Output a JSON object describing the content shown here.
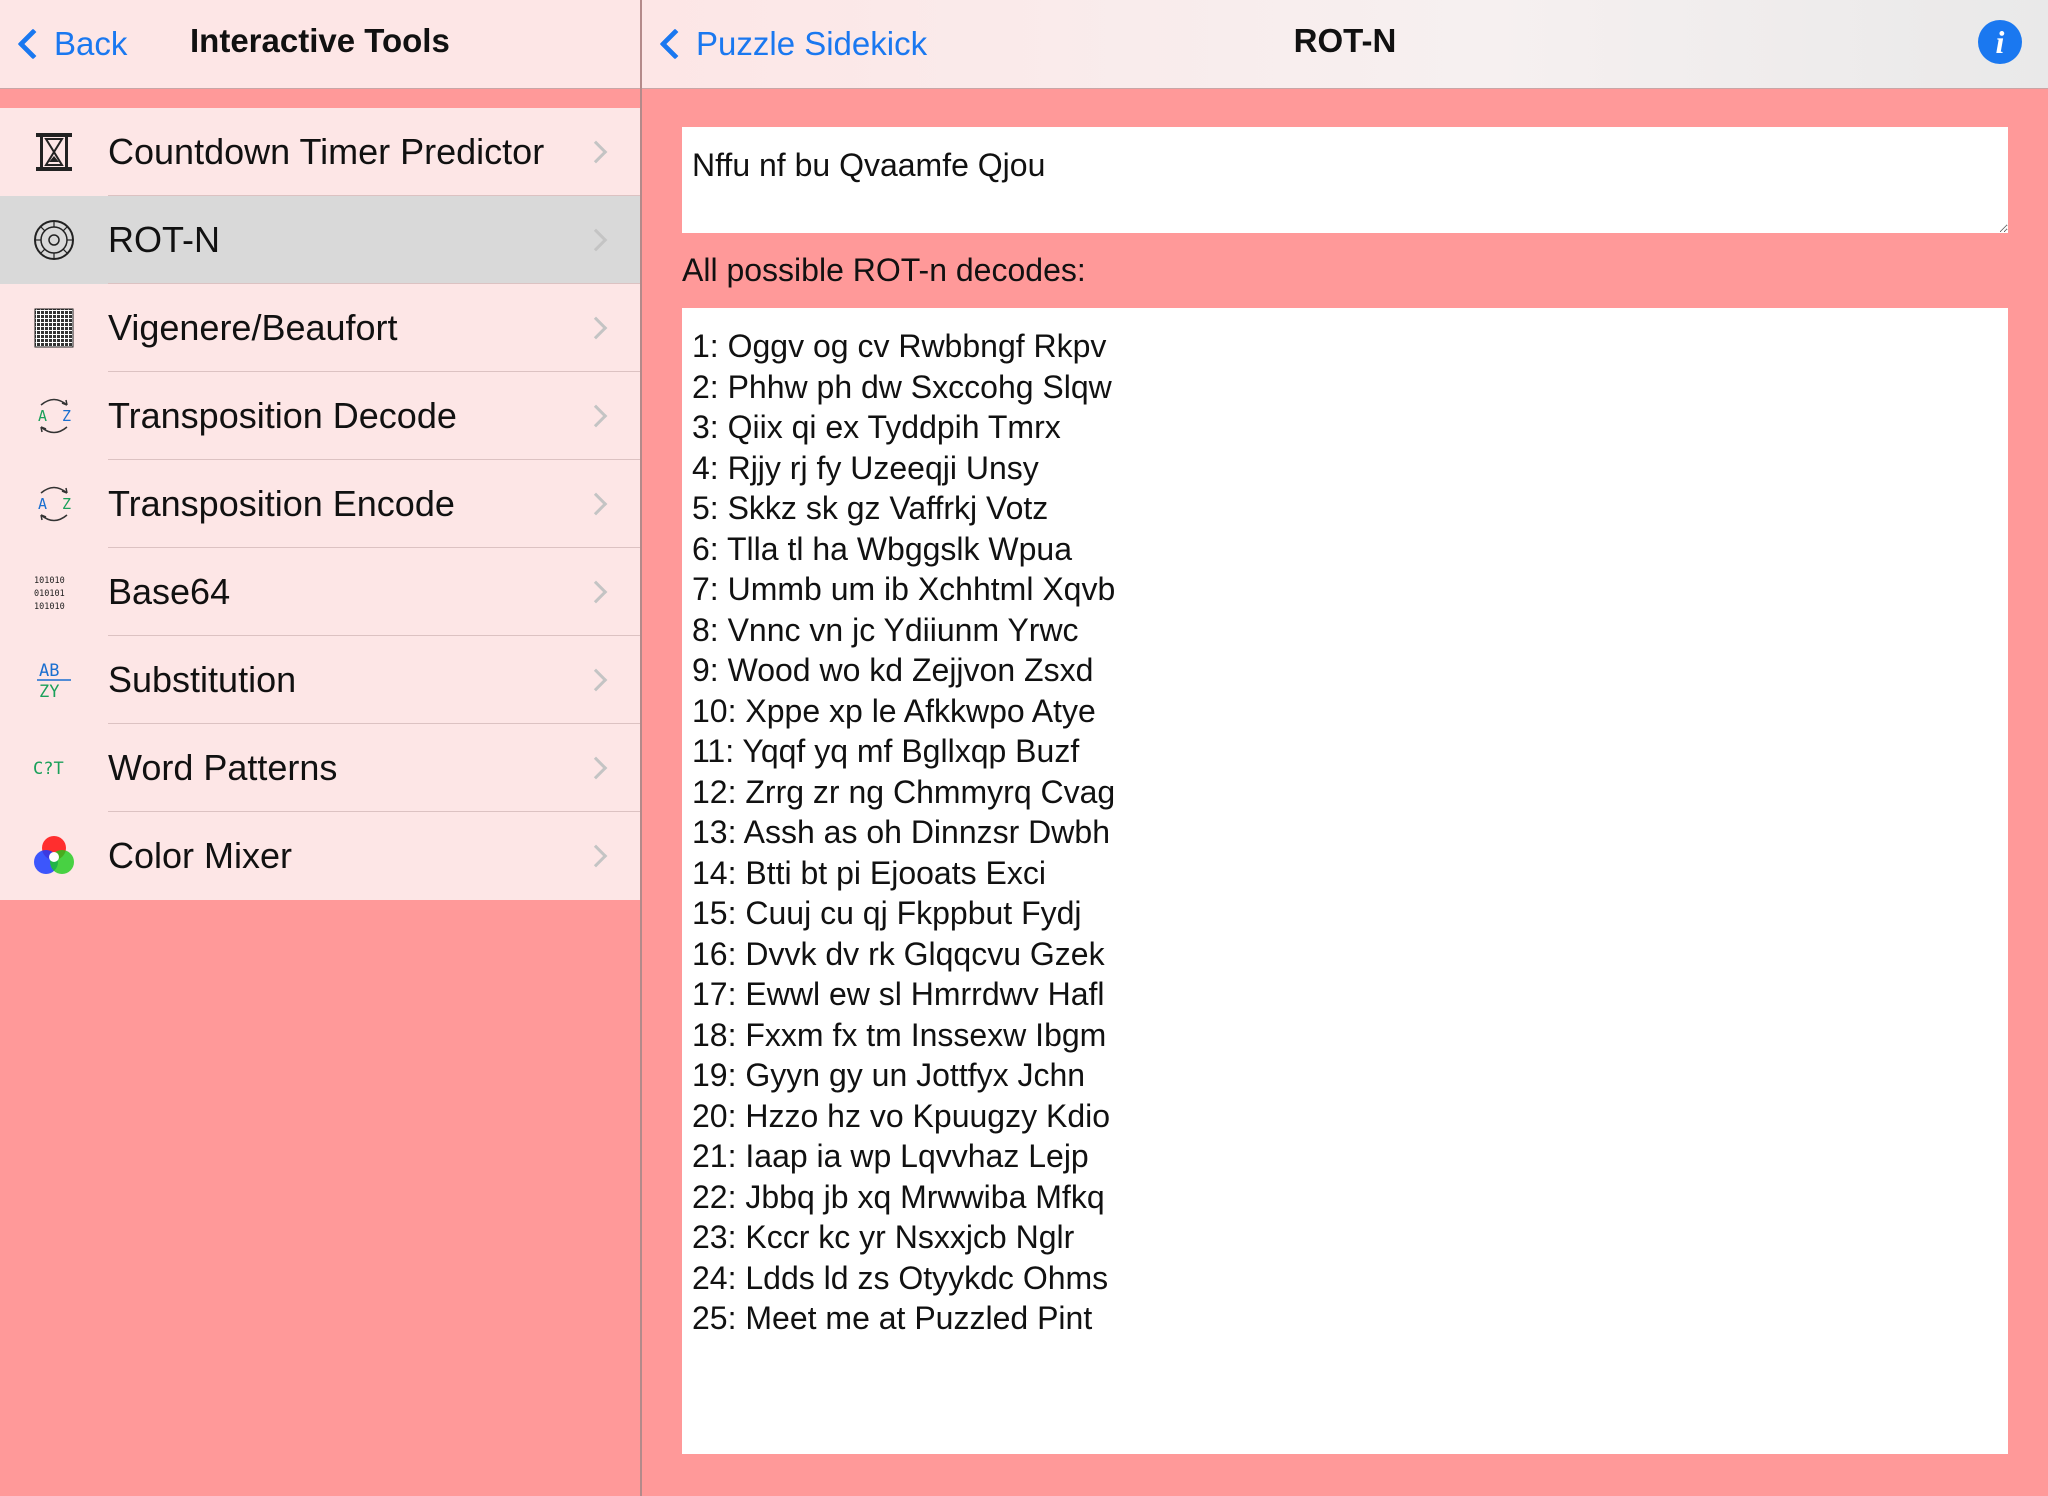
{
  "master": {
    "back_label": "Back",
    "title": "Interactive Tools",
    "items": [
      {
        "label": "Countdown Timer Predictor",
        "icon": "hourglass-icon"
      },
      {
        "label": "ROT-N",
        "icon": "dial-icon",
        "selected": true
      },
      {
        "label": "Vigenere/Beaufort",
        "icon": "grid-icon"
      },
      {
        "label": "Transposition Decode",
        "icon": "swap-az-icon"
      },
      {
        "label": "Transposition Encode",
        "icon": "swap-az-icon"
      },
      {
        "label": "Base64",
        "icon": "binary-icon"
      },
      {
        "label": "Substitution",
        "icon": "substitution-icon"
      },
      {
        "label": "Word Patterns",
        "icon": "word-pattern-icon"
      },
      {
        "label": "Color Mixer",
        "icon": "color-wheel-icon"
      }
    ],
    "icon_text": {
      "az_top": "A",
      "az_bottom": "Z",
      "binary_1": "101010",
      "binary_2": "010101",
      "binary_3": "101010",
      "sub_top": "AB",
      "sub_bottom": "ZY",
      "pattern": "C?T"
    }
  },
  "detail": {
    "back_label": "Puzzle Sidekick",
    "title": "ROT-N",
    "info_icon": "info-icon",
    "input_value": "Nffu nf bu Qvaamfe Qjou",
    "results_label": "All possible ROT-n decodes:",
    "results": [
      "1: Oggv og cv Rwbbngf Rkpv",
      "2: Phhw ph dw Sxccohg Slqw",
      "3: Qiix qi ex Tyddpih Tmrx",
      "4: Rjjy rj fy Uzeeqji Unsy",
      "5: Skkz sk gz Vaffrkj Votz",
      "6: Tlla tl ha Wbggslk Wpua",
      "7: Ummb um ib Xchhtml Xqvb",
      "8: Vnnc vn jc Ydiiunm Yrwc",
      "9: Wood wo kd Zejjvon Zsxd",
      "10: Xppe xp le Afkkwpo Atye",
      "11: Yqqf yq mf Bgllxqp Buzf",
      "12: Zrrg zr ng Chmmyrq Cvag",
      "13: Assh as oh Dinnzsr Dwbh",
      "14: Btti bt pi Ejooats Exci",
      "15: Cuuj cu qj Fkppbut Fydj",
      "16: Dvvk dv rk Glqqcvu Gzek",
      "17: Ewwl ew sl Hmrrdwv Hafl",
      "18: Fxxm fx tm Inssexw Ibgm",
      "19: Gyyn gy un Jottfyx Jchn",
      "20: Hzzo hz vo Kpuugzy Kdio",
      "21: Iaap ia wp Lqvvhaz Lejp",
      "22: Jbbq jb xq Mrwwiba Mfkq",
      "23: Kccr kc yr Nsxxjcb Nglr",
      "24: Ldds ld zs Otyykdc Ohms",
      "25: Meet me at Puzzled Pint"
    ]
  },
  "colors": {
    "background": "#ff9999",
    "list_background": "#fde6e6",
    "selected_row": "#d9d9d9",
    "accent": "#1a78f0"
  }
}
